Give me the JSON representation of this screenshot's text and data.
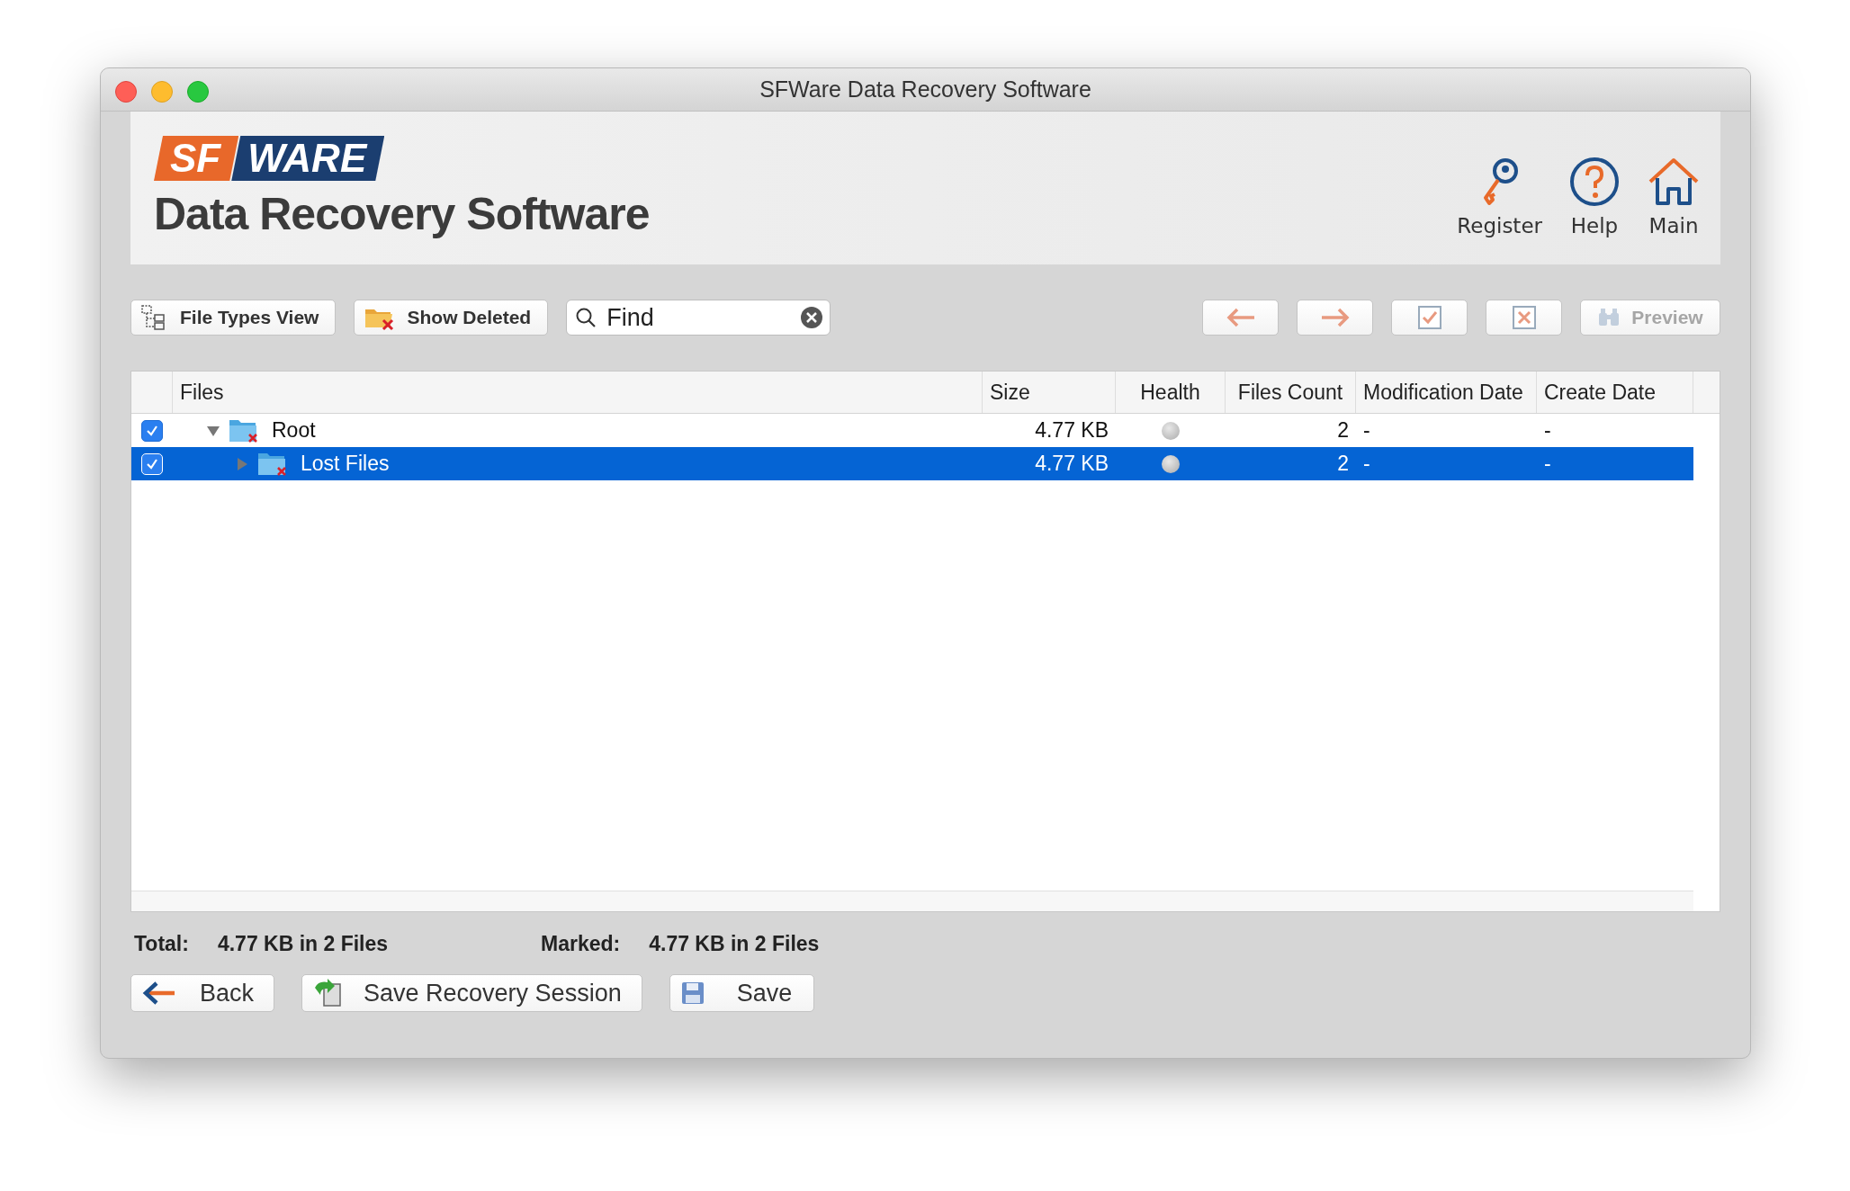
{
  "window": {
    "title": "SFWare Data Recovery Software"
  },
  "header": {
    "logo": [
      "SF",
      "WARE"
    ],
    "title": "Data Recovery Software",
    "actions": [
      {
        "kind": "key",
        "label": "Register"
      },
      {
        "kind": "help",
        "label": "Help"
      },
      {
        "kind": "home",
        "label": "Main"
      }
    ]
  },
  "toolbar": {
    "left": [
      {
        "kind": "tree",
        "label": "File Types View"
      },
      {
        "kind": "deleted",
        "label": "Show Deleted"
      }
    ],
    "search": {
      "placeholder": "Find"
    },
    "right": [
      {
        "kind": "back",
        "disabled": false
      },
      {
        "kind": "forward",
        "disabled": false
      },
      {
        "kind": "check",
        "disabled": false
      },
      {
        "kind": "uncheck",
        "disabled": false
      },
      {
        "kind": "preview",
        "label": "Preview",
        "disabled": true
      }
    ]
  },
  "table": {
    "columns": [
      "Files",
      "Size",
      "Health",
      "Files Count",
      "Modification Date",
      "Create Date"
    ],
    "rows": [
      {
        "name": "Root",
        "checked": true,
        "selected": false,
        "expanded": true,
        "size": "4.77 KB",
        "files_count": "2",
        "modification_date": "-",
        "create_date": "-",
        "children": [
          {
            "name": "Lost Files",
            "checked": true,
            "selected": true,
            "expanded": false,
            "size": "4.77 KB",
            "files_count": "2",
            "modification_date": "-",
            "create_date": "-"
          }
        ]
      }
    ]
  },
  "summary": [
    {
      "label": "Total:",
      "value": "4.77 KB in 2 Files"
    },
    {
      "label": "Marked:",
      "value": "4.77 KB in 2 Files"
    }
  ],
  "buttons": [
    {
      "kind": "back",
      "label": "Back"
    },
    {
      "kind": "session",
      "label": "Save Recovery Session"
    },
    {
      "kind": "save",
      "label": "Save"
    }
  ]
}
